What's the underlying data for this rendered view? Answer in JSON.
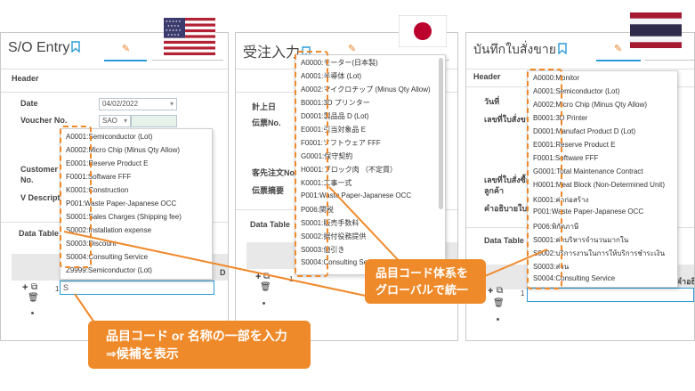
{
  "colors": {
    "accent": "#ef8a2a",
    "highlight_border": "#f0892a",
    "tab_blue": "#2b9bd8",
    "input_green": "#e6f2ea"
  },
  "flags": {
    "us": "us-flag-icon",
    "jp": "jp-flag-icon",
    "th": "th-flag-icon"
  },
  "us": {
    "title": "S/O Entry",
    "header_label": "Header",
    "date_label": "Date",
    "date_value": "04/02/2022",
    "voucher_label": "Voucher No.",
    "voucher_value": "SAO",
    "customer_label_1": "Customer or",
    "customer_label_2": "No.",
    "v_descript_label": "V Descript",
    "data_table_label": "Data Table",
    "col_label": "D I",
    "row_no": "1",
    "search_value": "S",
    "items": [
      "A0001:Semiconductor (Lot)",
      "A0002:Micro Chip (Minus Qty Allow)",
      "E0001:Reserve Product E",
      "F0001:Software FFF",
      "K0001:Construction",
      "P001:Waste Paper-Japanese OCC",
      "S0001:Sales Charges (Shipping fee)",
      "S0002:Installation expense",
      "S0003:Discount",
      "S0004:Consulting Service",
      "Z9999:Semiconductor (Lot)"
    ]
  },
  "jp": {
    "title": "受注入力",
    "keijo_label": "計上日",
    "denpyo_label": "伝票No.",
    "kyaku_label": "客先注文No.",
    "tekiyo_label": "伝票摘要",
    "data_table_label": "Data Table",
    "row_no": "1",
    "items": [
      "A0000:モーター(日本製)",
      "A0001:半導体 (Lot)",
      "A0002:マイクロチップ (Minus Qty Allow)",
      "B0001:3D プリンター",
      "D0001:製品品 D (Lot)",
      "E0001:引当対象品 E",
      "F0001:ソフトウェア FFF",
      "G0001:保守契約",
      "H0001:ブロック肉 （不定貫）",
      "K0001:工事一式",
      "P001:Waste Paper-Japanese OCC",
      "P006:関税",
      "S0001:販売手数料",
      "S0002:据付役務提供",
      "S0003:値引き",
      "S0004:Consulting Se"
    ]
  },
  "th": {
    "title": "บันทึกใบสั่งขาย",
    "header_label": "Header",
    "date_label": "วันที่",
    "doc_label": "เลขที่ใบสั่งขาย",
    "cust_label_1": "เลขที่ใบสั่งซื้อ",
    "cust_label_2": "ลูกค้า",
    "desc_label": "คำอธิบายใบสั่ง",
    "data_table_label": "Data Table",
    "row_no": "1",
    "col_label": "คำอธิ",
    "items": [
      "A0000:Monitor",
      "A0001:Semiconductor (Lot)",
      "A0002:Micro Chip (Minus Qty Allow)",
      "B0001:3D Printer",
      "D0001:Manufact Product D (Lot)",
      "E0001:Reserve Product E",
      "F0001:Software FFF",
      "G0001:Total Maintenance Contract",
      "H0001:Meat Block (Non-Determined Unit)",
      "K0001:ค่าก่อสร้าง",
      "P001:Waste Paper-Japanese OCC",
      "P006:พิกัดภาษี",
      "S0001:ค่าบริหารจำนวนมากใน",
      "S0002:บริการงานในการให้บริการชำระเงิน",
      "S0003:ส่วน",
      "S0004:Consulting Service"
    ]
  },
  "callouts": {
    "input_line1": "品目コード or 名称の一部を入力",
    "input_line2": "⇒候補を表示",
    "unify_line1": "品目コード体系を",
    "unify_line2": "グローバルで統一"
  }
}
